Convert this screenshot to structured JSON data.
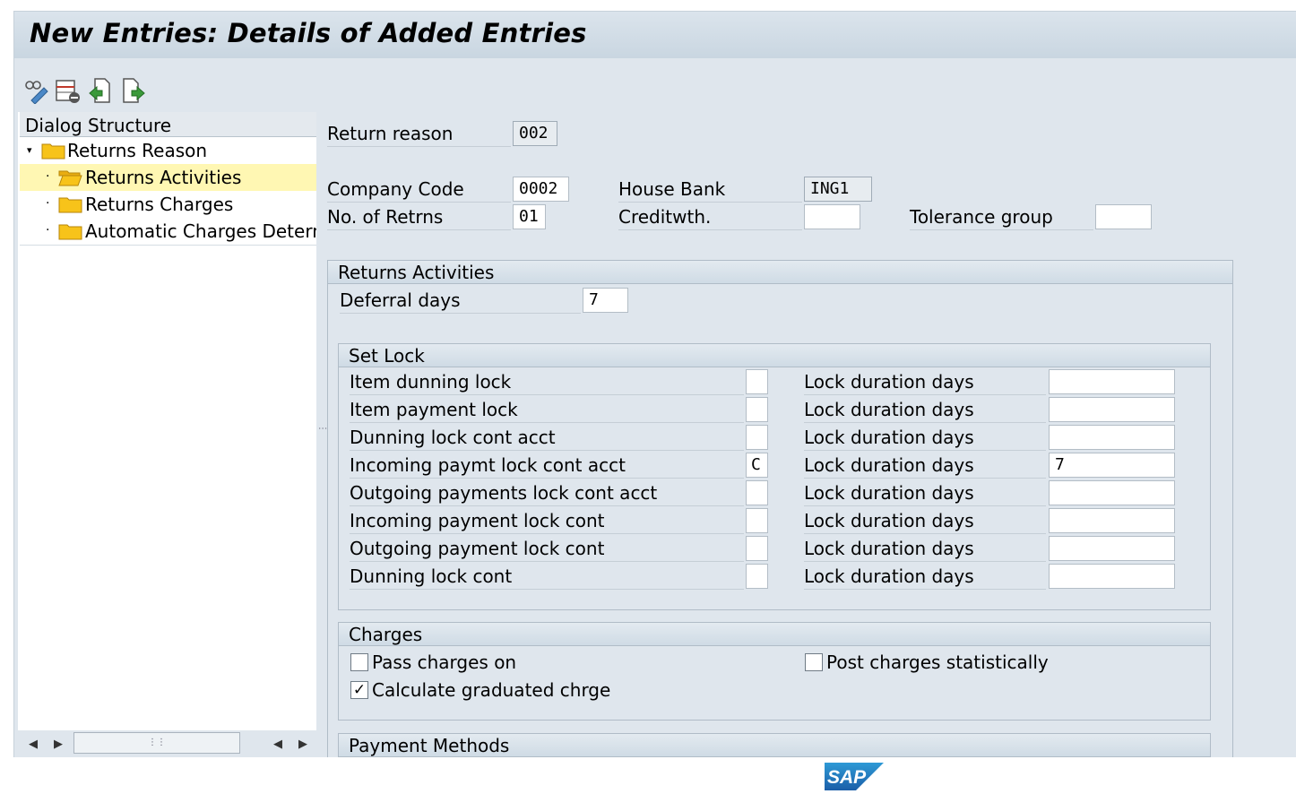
{
  "window": {
    "title": "New Entries: Details of Added Entries"
  },
  "toolbar": {
    "buttons": [
      "display-change-icon",
      "delete-icon",
      "undo-icon",
      "next-entry-icon"
    ]
  },
  "dialog_structure": {
    "header": "Dialog Structure",
    "items": [
      {
        "label": "Returns Reason",
        "level": 0,
        "selected": false,
        "expanded": true
      },
      {
        "label": "Returns Activities",
        "level": 1,
        "selected": true
      },
      {
        "label": "Returns Charges",
        "level": 1,
        "selected": false
      },
      {
        "label": "Automatic Charges Determina",
        "level": 1,
        "selected": false
      }
    ]
  },
  "header_fields": {
    "return_reason": {
      "label": "Return reason",
      "value": "002"
    },
    "company_code": {
      "label": "Company Code",
      "value": "0002"
    },
    "house_bank": {
      "label": "House Bank",
      "value": "ING1"
    },
    "no_of_returns": {
      "label": "No. of Retrns",
      "value": "01"
    },
    "creditworthiness": {
      "label": "Creditwth.",
      "value": ""
    },
    "tolerance_group": {
      "label": "Tolerance group",
      "value": ""
    }
  },
  "returns_activities": {
    "title": "Returns Activities",
    "deferral_days": {
      "label": "Deferral days",
      "value": "7"
    }
  },
  "set_lock": {
    "title": "Set Lock",
    "rows": [
      {
        "label": "Item dunning lock",
        "lock": "",
        "duration_label": "Lock duration days",
        "duration": ""
      },
      {
        "label": "Item payment lock",
        "lock": "",
        "duration_label": "Lock duration days",
        "duration": ""
      },
      {
        "label": "Dunning lock cont acct",
        "lock": "",
        "duration_label": "Lock duration days",
        "duration": ""
      },
      {
        "label": "Incoming paymt lock cont acct",
        "lock": "C",
        "duration_label": "Lock duration days",
        "duration": "7"
      },
      {
        "label": "Outgoing payments lock cont acct",
        "lock": "",
        "duration_label": "Lock duration days",
        "duration": ""
      },
      {
        "label": "Incoming payment lock cont",
        "lock": "",
        "duration_label": "Lock duration days",
        "duration": ""
      },
      {
        "label": "Outgoing payment lock cont",
        "lock": "",
        "duration_label": "Lock duration days",
        "duration": ""
      },
      {
        "label": "Dunning lock cont",
        "lock": "",
        "duration_label": "Lock duration days",
        "duration": ""
      }
    ]
  },
  "charges": {
    "title": "Charges",
    "pass_charges_on": {
      "label": "Pass charges on",
      "checked": false
    },
    "post_charges_statistically": {
      "label": "Post charges statistically",
      "checked": false
    },
    "calculate_graduated_charge": {
      "label": "Calculate graduated chrge",
      "checked": true
    }
  },
  "payment_methods": {
    "title": "Payment Methods"
  },
  "brand": {
    "logo_text": "SAP",
    "logo_color": "#1b75bb"
  }
}
